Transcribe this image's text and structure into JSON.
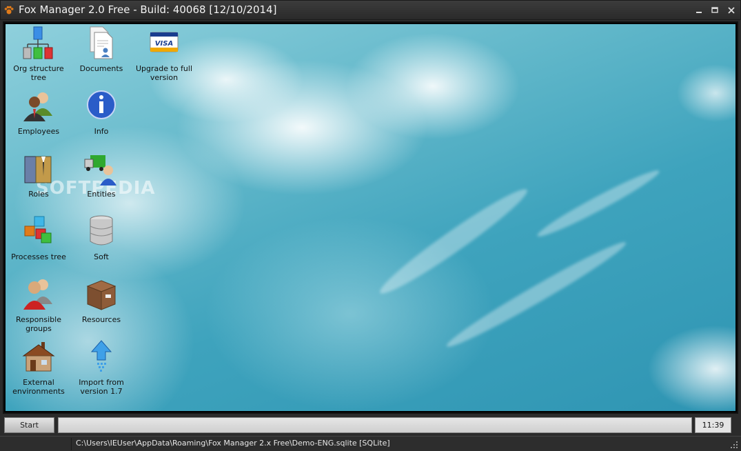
{
  "window": {
    "title": "Fox Manager 2.0 Free - Build: 40068 [12/10/2014]",
    "controls": {
      "minimize": "minimize-icon",
      "maximize": "maximize-icon",
      "close": "close-icon"
    }
  },
  "desktop": {
    "watermark": "SOFTPEDIA",
    "icons": [
      {
        "label": "Org structure tree",
        "icon": "org-structure-tree-icon"
      },
      {
        "label": "Documents",
        "icon": "documents-icon"
      },
      {
        "label": "Upgrade to full version",
        "icon": "visa-card-icon"
      },
      {
        "label": "Employees",
        "icon": "employees-icon"
      },
      {
        "label": "Info",
        "icon": "info-icon"
      },
      {
        "label": "Roles",
        "icon": "roles-icon"
      },
      {
        "label": "Entities",
        "icon": "entities-icon"
      },
      {
        "label": "Processes tree",
        "icon": "processes-tree-icon"
      },
      {
        "label": "Soft",
        "icon": "database-icon"
      },
      {
        "label": "Responsible groups",
        "icon": "responsible-groups-icon"
      },
      {
        "label": "Resources",
        "icon": "box-icon"
      },
      {
        "label": "External environments",
        "icon": "house-icon"
      },
      {
        "label": "Import from version 1.7",
        "icon": "import-arrow-icon"
      }
    ],
    "visa_text": "VISA"
  },
  "taskbar": {
    "start_label": "Start",
    "clock": "11:39 PM"
  },
  "statusbar": {
    "path": "C:\\Users\\IEUser\\AppData\\Roaming\\Fox Manager 2.x Free\\Demo-ENG.sqlite [SQLite]"
  },
  "colors": {
    "titlebar": "#2f2f2f",
    "sky": "#3ea3bd",
    "accent_orange": "#e07b1a"
  }
}
